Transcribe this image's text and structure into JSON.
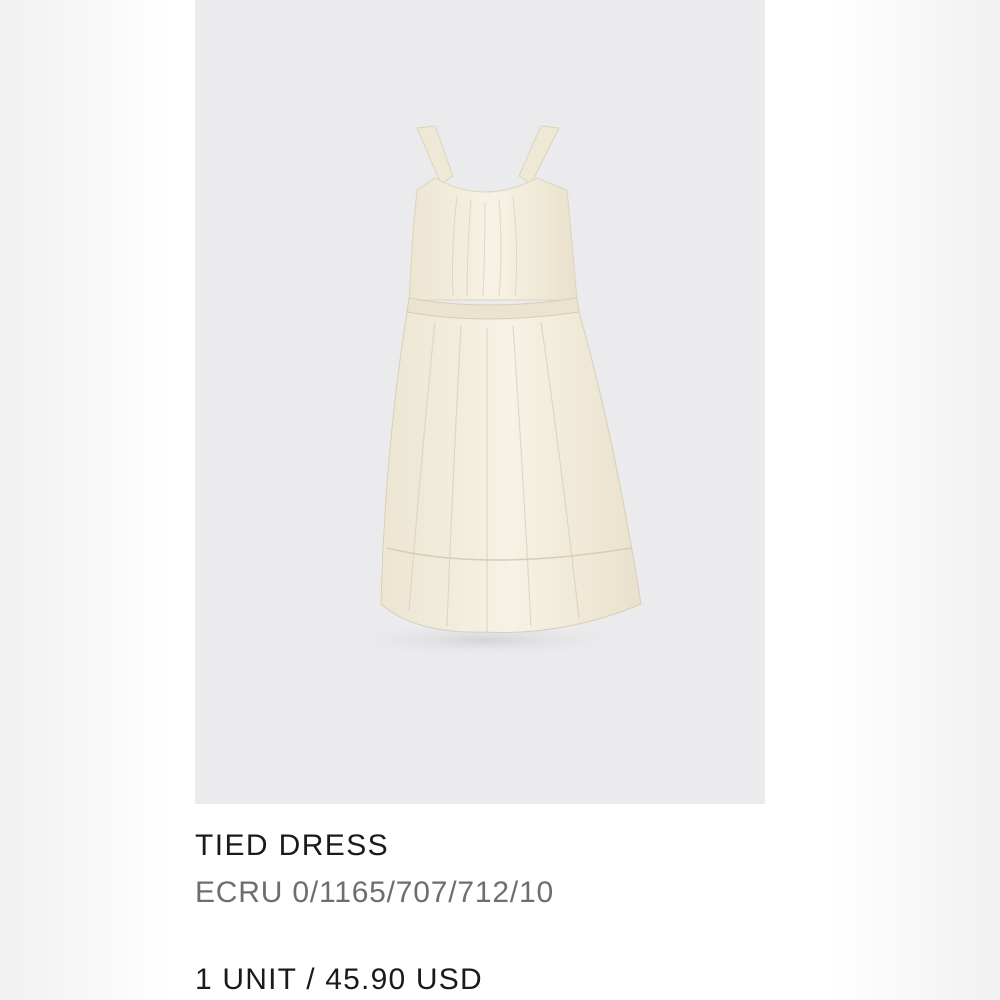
{
  "product": {
    "image_alt": "Ecru tied dress product photo",
    "name": "TIED DRESS",
    "reference": "ECRU 0/1165/707/712/10",
    "quantity_price": "1 UNIT / 45.90 USD"
  },
  "colors": {
    "photo_background": "#ebeaec",
    "dress": "#f5f0e0",
    "text_primary": "#1a1a1a",
    "text_secondary": "#6e6e6e"
  }
}
